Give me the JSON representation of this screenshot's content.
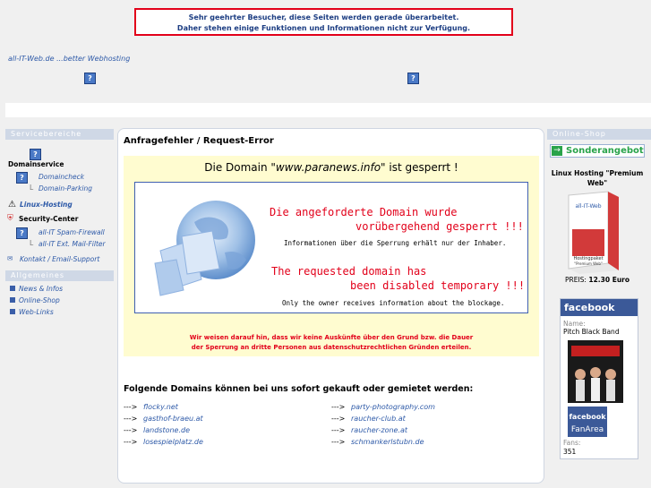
{
  "notice": {
    "line1": "Sehr geehrter Besucher, diese Seiten werden gerade überarbeitet.",
    "line2": "Daher stehen einige Funktionen und Informationen nicht zur Verfügung."
  },
  "brand": {
    "text": "all-IT-Web.de ...better Webhosting",
    "icon_glyph": "?"
  },
  "left_sidebar": {
    "service_heading": "Servicebereiche",
    "domainservice": "Domainservice",
    "domaincheck": "Domaincheck",
    "domain_parking": "Domain-Parking",
    "linux_hosting": "Linux-Hosting",
    "security_center": "Security-Center",
    "spam_firewall": "all-IT Spam-Firewall",
    "mail_filter": "all-IT Ext. Mail-Filter",
    "contact": "Kontakt / Email-Support",
    "general_heading": "Allgemeines",
    "news": "News & Infos",
    "online_shop": "Online-Shop",
    "web_links": "Web-Links",
    "tree_glyph": "L"
  },
  "main": {
    "title": "Anfragefehler / Request-Error",
    "domain_prefix": "Die Domain ",
    "domain_name": "\"www.paranews.info\"",
    "domain_suffix": " ist gesperrt !",
    "de_line1": "Die angeforderte Domain wurde",
    "de_line2": "vorübergehend gesperrt !!!",
    "de_info": "Informationen über die Sperrung erhält nur der Inhaber.",
    "en_line1": "The requested domain has",
    "en_line2": "been disabled temporary !!!",
    "en_info": "Only the owner receives information about the blockage.",
    "warning_line1": "Wir weisen darauf hin, dass wir keine Auskünfte über den Grund bzw. die Dauer",
    "warning_line2": "der Sperrung an dritte Personen aus datenschutzrechtlichen Gründen erteilen.",
    "domains_heading": "Folgende Domains können bei uns sofort gekauft oder gemietet werden:",
    "arrow": "--->",
    "domains_left": [
      "flocky.net",
      "gasthof-braeu.at",
      "landstone.de",
      "losespielplatz.de"
    ],
    "domains_right": [
      "party-photography.com",
      "raucher-club.at",
      "raucher-zone.at",
      "schmankerlstubn.de"
    ]
  },
  "right_sidebar": {
    "heading": "Online-Shop",
    "offer_arrow": "→",
    "offer_button": "Sonderangebot",
    "product_title": "Linux Hosting \"Premium Web\"",
    "box_logo": "all-IT-Web",
    "box_label": "Hostingpaket",
    "box_sub": "\"Premium Web\"",
    "price_label": "PREIS:",
    "price_value": "12.30 Euro",
    "fb_logo": "facebook",
    "fb_name_label": "Name:",
    "fb_name": "Pitch Black Band",
    "fb_badge_logo": "facebook",
    "fb_badge_text": "FanArea",
    "fb_fans_label": "Fans:",
    "fb_fans": "351"
  }
}
